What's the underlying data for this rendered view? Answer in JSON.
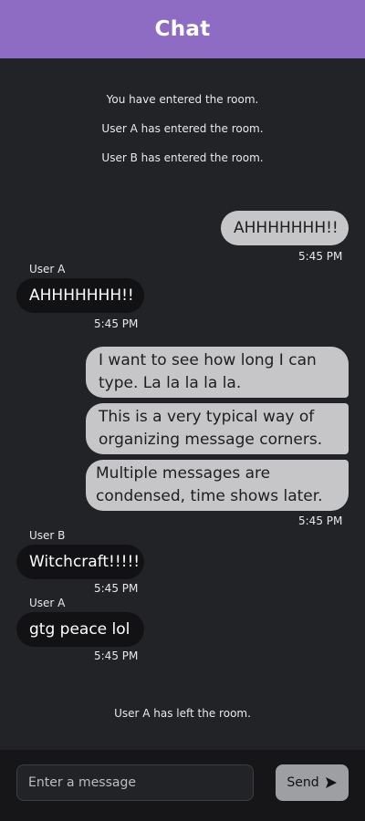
{
  "header": {
    "title": "Chat"
  },
  "system_messages": {
    "entered_you": "You have entered the room.",
    "entered_a": "User A has entered the room.",
    "entered_b": "User B has entered the room.",
    "left_a": "User A has left the room."
  },
  "messages": {
    "m1": {
      "text": "AHHHHHHH!!",
      "time": "5:45 PM"
    },
    "m2": {
      "sender": "User A",
      "text": "AHHHHHHH!!",
      "time": "5:45 PM"
    },
    "m3": {
      "line1a": "I want to see how long I can",
      "line1b": "type. La la la la la.",
      "line2a": "This is a very typical way of",
      "line2b": "organizing message corners.",
      "line3a": "Multiple messages are",
      "line3b": "condensed, time shows later.",
      "time": "5:45 PM"
    },
    "m4": {
      "sender": "User B",
      "text": "Witchcraft!!!!!",
      "time": "5:45 PM"
    },
    "m5": {
      "sender": "User A",
      "text": "gtg peace lol",
      "time": "5:45 PM"
    }
  },
  "composer": {
    "placeholder": "Enter a message",
    "send_label": "Send",
    "send_icon": "send-arrow-icon"
  },
  "colors": {
    "header": "#8e6cc4",
    "background": "#222327",
    "outgoing_bubble": "#c6c6c8",
    "incoming_bubble": "#121214"
  }
}
